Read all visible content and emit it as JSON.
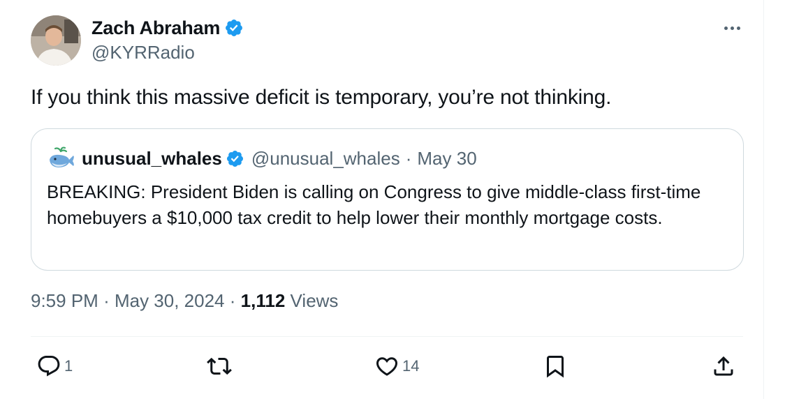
{
  "author": {
    "name": "Zach Abraham",
    "handle": "@KYRRadio",
    "verified": true
  },
  "tweet": {
    "text": "If you think this massive deficit is temporary, you’re not thinking."
  },
  "quote": {
    "name": "unusual_whales",
    "handle": "@unusual_whales",
    "separator": "·",
    "date": "May 30",
    "text": "BREAKING: President Biden is calling on Congress to give middle-class first-time homebuyers a $10,000 tax credit to help lower their monthly mortgage costs."
  },
  "meta": {
    "time": "9:59 PM",
    "sep1": "·",
    "date": "May 30, 2024",
    "sep2": "·",
    "views_count": "1,112",
    "views_label": "Views"
  },
  "actions": {
    "reply_count": "1",
    "repost_count": "",
    "like_count": "14"
  },
  "colors": {
    "verified": "#1d9bf0",
    "secondary_text": "#536471",
    "primary_text": "#0f1419",
    "border": "#cfd9de"
  },
  "icons": [
    "verified-badge-icon",
    "more-icon",
    "whale-avatar-icon",
    "reply-icon",
    "repost-icon",
    "like-icon",
    "bookmark-icon",
    "share-icon"
  ]
}
